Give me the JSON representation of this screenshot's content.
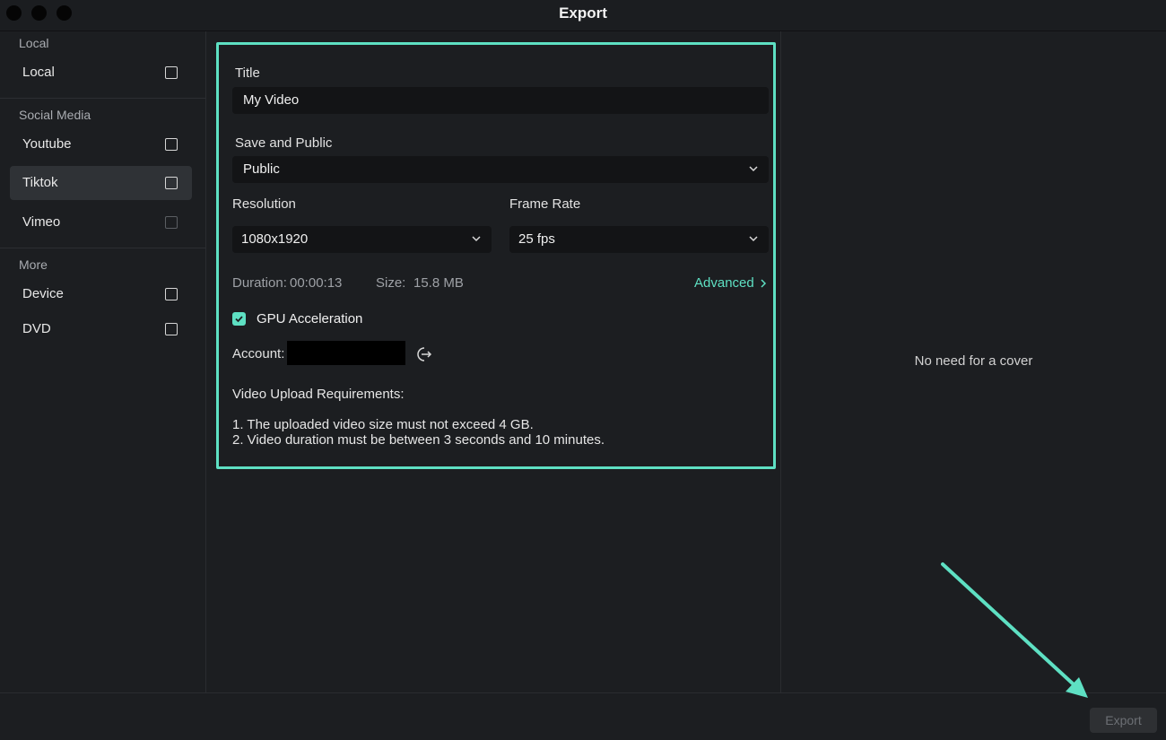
{
  "window": {
    "title": "Export"
  },
  "sidebar": {
    "sections": [
      {
        "label": "Local",
        "items": [
          {
            "label": "Local",
            "active": false
          }
        ]
      },
      {
        "label": "Social Media",
        "items": [
          {
            "label": "Youtube",
            "active": false
          },
          {
            "label": "Tiktok",
            "active": true
          },
          {
            "label": "Vimeo",
            "active": false
          }
        ]
      },
      {
        "label": "More",
        "items": [
          {
            "label": "Device",
            "active": false
          },
          {
            "label": "DVD",
            "active": false
          }
        ]
      }
    ]
  },
  "form": {
    "title_label": "Title",
    "title_value": "My Video",
    "privacy_label": "Save and Public",
    "privacy_value": "Public",
    "resolution_label": "Resolution",
    "resolution_value": "1080x1920",
    "framerate_label": "Frame Rate",
    "framerate_value": "25 fps",
    "duration_label": "Duration:",
    "duration_value": "00:00:13",
    "size_label": "Size:",
    "size_value": "15.8 MB",
    "advanced_label": "Advanced",
    "gpu_label": "GPU Acceleration",
    "gpu_checked": true,
    "account_label": "Account:",
    "requirements_title": "Video Upload Requirements:",
    "requirements": [
      "1. The uploaded video size must not exceed 4 GB.",
      "2. Video duration must be between 3 seconds and 10 minutes."
    ]
  },
  "preview": {
    "cover_message": "No need for a cover"
  },
  "footer": {
    "export_label": "Export"
  },
  "colors": {
    "accent": "#5ee0c3",
    "background": "#1c1e21",
    "field": "#131416",
    "active_item": "#2f3236"
  },
  "icons": [
    "chevron-down-icon",
    "chevron-right-icon",
    "logout-icon",
    "checkmark-icon"
  ]
}
